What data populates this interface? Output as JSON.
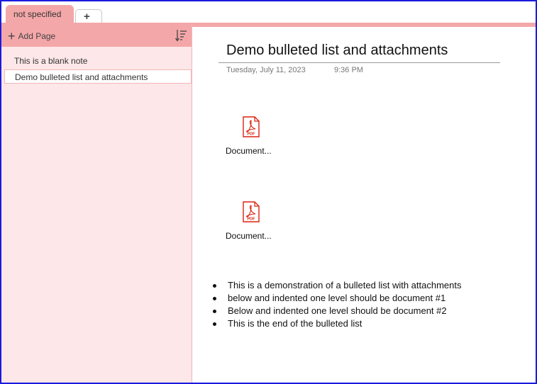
{
  "tabs": {
    "active_label": "not specified",
    "add_label": "+"
  },
  "sidebar": {
    "add_page_label": "Add Page",
    "pages": [
      {
        "label": "This is a blank note"
      },
      {
        "label": "Demo bulleted list and attachments"
      }
    ]
  },
  "page": {
    "title": "Demo bulleted list and attachments",
    "date": "Tuesday, July 11, 2023",
    "time": "9:36 PM",
    "attachments": [
      {
        "name": "Document...",
        "icon": "pdf-icon",
        "type_label": "PDF"
      },
      {
        "name": "Document...",
        "icon": "pdf-icon",
        "type_label": "PDF"
      }
    ],
    "bullets": [
      "This is a demonstration of a bulleted list with attachments",
      "below and indented one level should be document #1",
      "Below and indented one level should be document #2",
      "This is the end of the bulleted list"
    ]
  },
  "colors": {
    "section_accent": "#f4a7a9",
    "sidebar_bg": "#fde7e8",
    "window_border": "#1a1adf",
    "pdf_red": "#d9230f"
  }
}
